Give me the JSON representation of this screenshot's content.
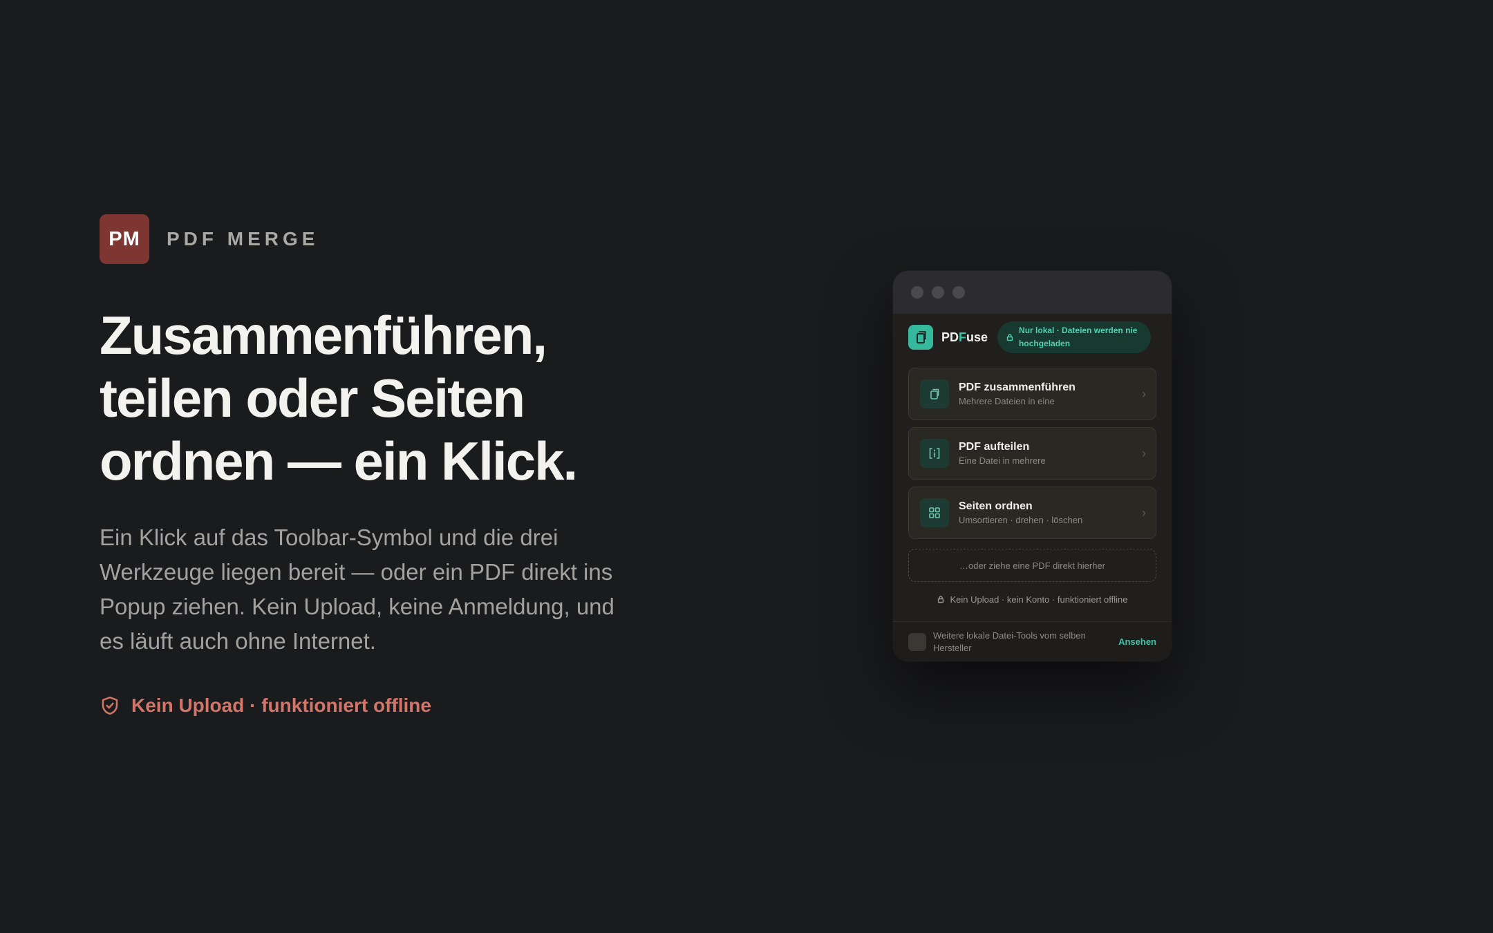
{
  "brand": {
    "logo_text": "PM",
    "name": "PDF MERGE",
    "logo_color": "#7d3631"
  },
  "hero": {
    "headline_lines": [
      "Zusammenführen,",
      "teilen oder Seiten",
      "ordnen — ein Klick."
    ],
    "lead_lines": [
      "Ein Klick auf das Toolbar-Symbol und die drei",
      "Werkzeuge liegen bereit — oder ein PDF direkt ins",
      "Popup ziehen. Kein Upload, keine Anmeldung, und",
      "es läuft auch ohne Internet."
    ],
    "trust_icon": "shield-check-icon",
    "trust_text": "Kein Upload · funktioniert offline",
    "accent_color": "#d47569"
  },
  "popup": {
    "app_name_prefix": "PD",
    "app_name_accent": "F",
    "app_name_suffix": "use",
    "app_icon": "document-icon",
    "badge_lines": [
      "Nur lokal · Dateien werden nie",
      "hochgeladen"
    ],
    "tools": [
      {
        "icon": "copy-icon",
        "title": "PDF zusammenführen",
        "subtitle": "Mehrere Dateien in eine"
      },
      {
        "icon": "split-icon",
        "title": "PDF aufteilen",
        "subtitle": "Eine Datei in mehrere"
      },
      {
        "icon": "grid-icon",
        "title": "Seiten ordnen",
        "subtitle": "Umsortieren · drehen · löschen"
      }
    ],
    "dropzone_text": "…oder ziehe eine PDF direkt hierher",
    "privacy_text": "Kein Upload · kein Konto · funktioniert offline",
    "footer_lines": [
      "Weitere lokale Datei-Tools vom selben",
      "Hersteller"
    ],
    "footer_link": "Ansehen",
    "accent_color": "#3fc4a5"
  }
}
